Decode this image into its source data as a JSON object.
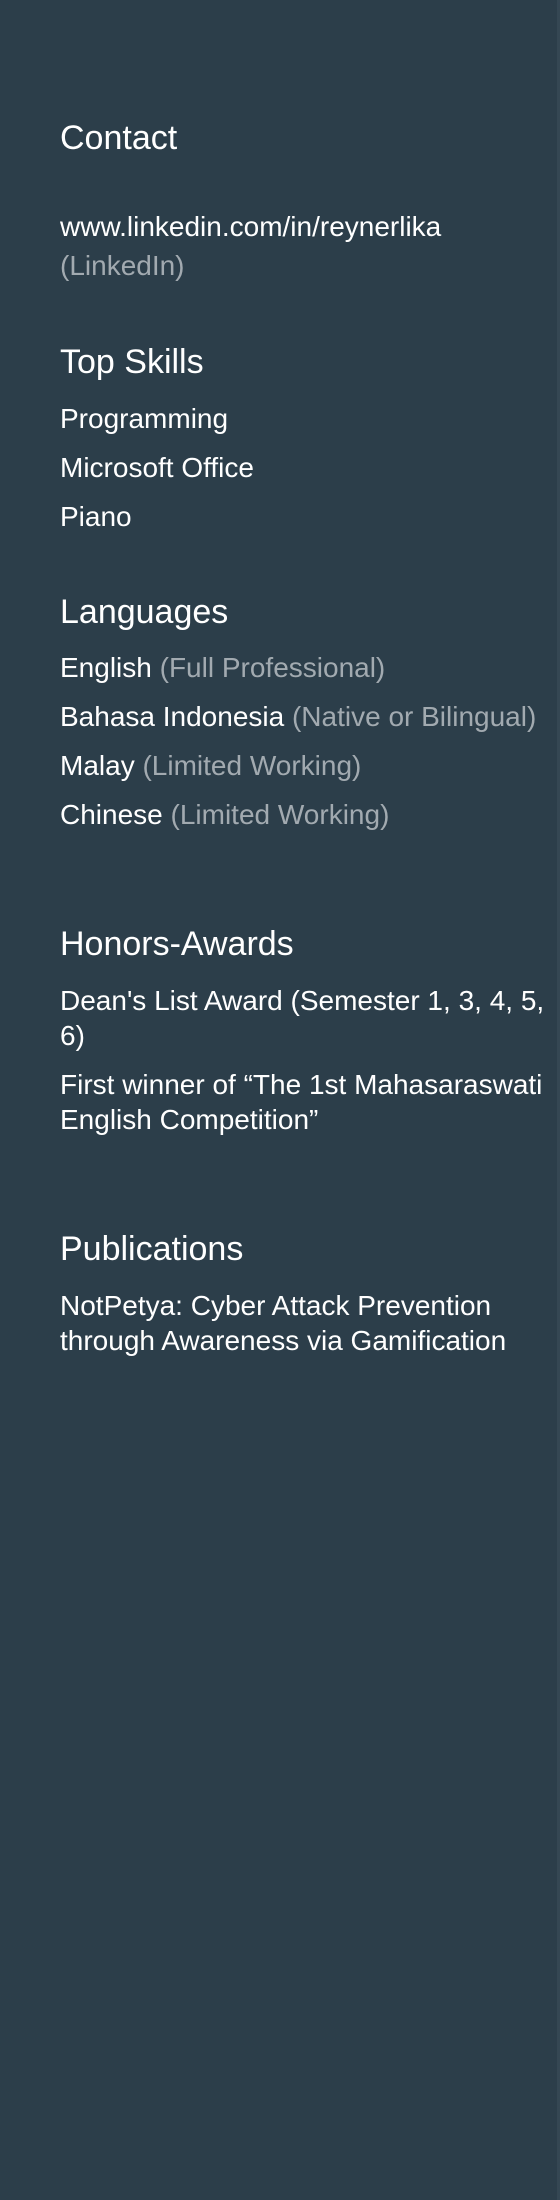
{
  "contact": {
    "heading": "Contact",
    "url": "www.linkedin.com/in/reynerlika",
    "url_type": "(LinkedIn)"
  },
  "skills": {
    "heading": "Top Skills",
    "items": [
      "Programming",
      "Microsoft Office",
      "Piano"
    ]
  },
  "languages": {
    "heading": "Languages",
    "items": [
      {
        "name": "English",
        "level": "(Full Professional)"
      },
      {
        "name": "Bahasa Indonesia",
        "level": "(Native or Bilingual)"
      },
      {
        "name": "Malay",
        "level": "(Limited Working)"
      },
      {
        "name": "Chinese",
        "level": "(Limited Working)"
      }
    ]
  },
  "honors": {
    "heading": "Honors-Awards",
    "items": [
      "Dean's List Award (Semester 1, 3, 4, 5, 6)",
      "First winner of “The 1st Mahasaraswati English Competition”"
    ]
  },
  "publications": {
    "heading": "Publications",
    "items": [
      "NotPetya: Cyber Attack Prevention through Awareness via Gamification"
    ]
  },
  "colors": {
    "background": "#2c3e4a",
    "text": "#ffffff",
    "muted": "#a2aab0"
  }
}
